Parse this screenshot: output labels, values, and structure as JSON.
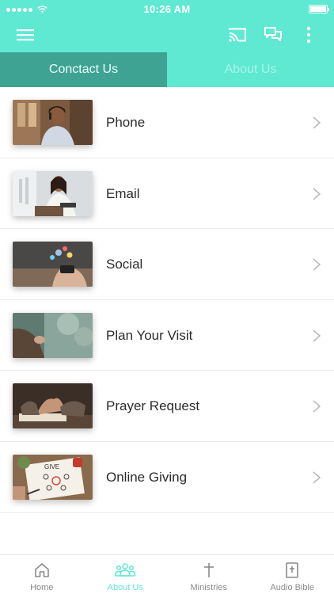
{
  "status_bar": {
    "time": "10:26 AM"
  },
  "app_bar": {
    "icons": [
      "menu-icon",
      "cast-icon",
      "chat-icon",
      "more-vert-icon"
    ]
  },
  "tabs": [
    {
      "label": "Conctact Us",
      "active": true
    },
    {
      "label": "About Us",
      "active": false
    }
  ],
  "list": [
    {
      "label": "Phone"
    },
    {
      "label": "Email"
    },
    {
      "label": "Social"
    },
    {
      "label": "Plan Your Visit"
    },
    {
      "label": "Prayer Request"
    },
    {
      "label": "Online Giving"
    }
  ],
  "bottom_nav": [
    {
      "label": "Home",
      "icon": "home-icon",
      "active": false
    },
    {
      "label": "About Us",
      "icon": "people-icon",
      "active": true
    },
    {
      "label": "Ministries",
      "icon": "cross-icon",
      "active": false
    },
    {
      "label": "Audio Bible",
      "icon": "bible-icon",
      "active": false
    }
  ],
  "colors": {
    "accent": "#5fe8d2",
    "tab_active": "#3fa394",
    "text": "#2b2b2b"
  }
}
